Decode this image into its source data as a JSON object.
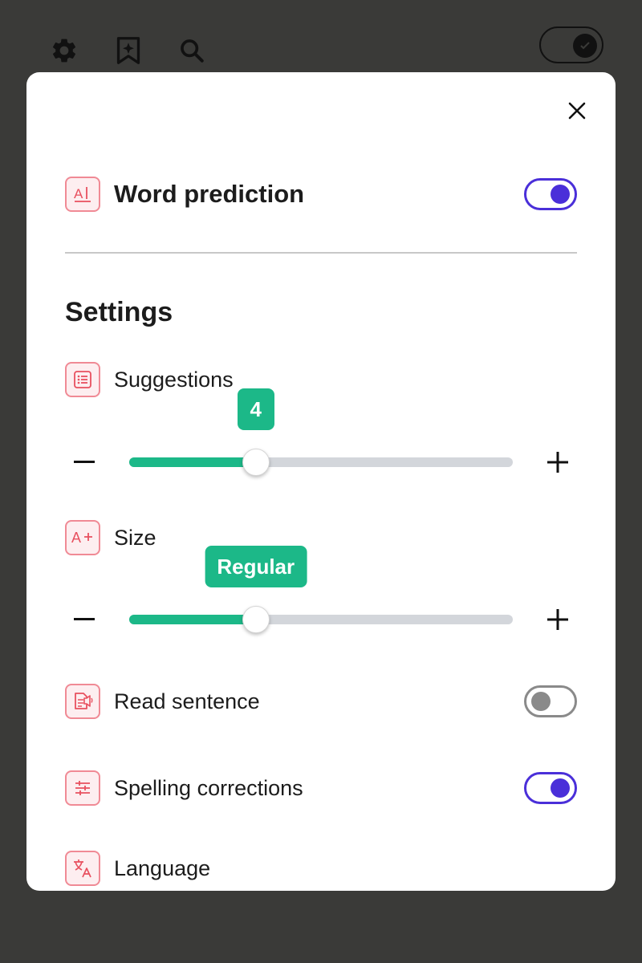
{
  "topbar": {
    "icons": [
      "gear-icon",
      "sparkle-bookmark-icon",
      "search-icon"
    ]
  },
  "modal": {
    "close_icon": "close-icon",
    "word_prediction": {
      "label": "Word prediction",
      "enabled": true,
      "icon": "text-cursor-icon"
    },
    "settings_title": "Settings",
    "suggestions": {
      "label": "Suggestions",
      "value": "4",
      "level": 0.33,
      "icon": "list-icon"
    },
    "size": {
      "label": "Size",
      "value": "Regular",
      "level": 0.33,
      "icon": "text-size-icon"
    },
    "read_sentence": {
      "label": "Read sentence",
      "enabled": false,
      "icon": "speaker-document-icon"
    },
    "spelling_corrections": {
      "label": "Spelling corrections",
      "enabled": true,
      "icon": "sliders-icon"
    },
    "language": {
      "label": "Language",
      "icon": "translate-icon"
    }
  },
  "colors": {
    "accent": "#4a2fd9",
    "slider_fill": "#1cb888",
    "icon_border": "#f08a95",
    "backdrop": "#3a3a38"
  }
}
